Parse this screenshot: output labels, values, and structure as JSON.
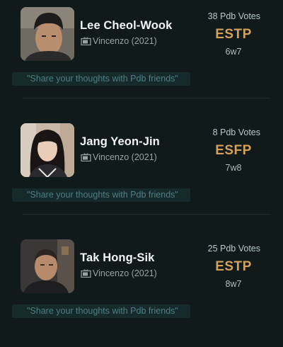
{
  "people": [
    {
      "name": "Lee Cheol-Wook",
      "show": "Vincenzo (2021)",
      "votes": "38 Pdb Votes",
      "mbti": "ESTP",
      "enneagram": "6w7",
      "comment_placeholder": "\"Share your thoughts with Pdb friends\""
    },
    {
      "name": "Jang Yeon-Jin",
      "show": "Vincenzo (2021)",
      "votes": "8 Pdb Votes",
      "mbti": "ESFP",
      "enneagram": "7w8",
      "comment_placeholder": "\"Share your thoughts with Pdb friends\""
    },
    {
      "name": "Tak Hong-Sik",
      "show": "Vincenzo (2021)",
      "votes": "25 Pdb Votes",
      "mbti": "ESTP",
      "enneagram": "8w7",
      "comment_placeholder": "\"Share your thoughts with Pdb friends\""
    }
  ],
  "colors": {
    "background": "#111a1a",
    "mbti_accent": "#d4a15a",
    "comment_box": "#16292b",
    "comment_text": "#4f7f84"
  },
  "icons": {
    "show": "tv-icon"
  }
}
